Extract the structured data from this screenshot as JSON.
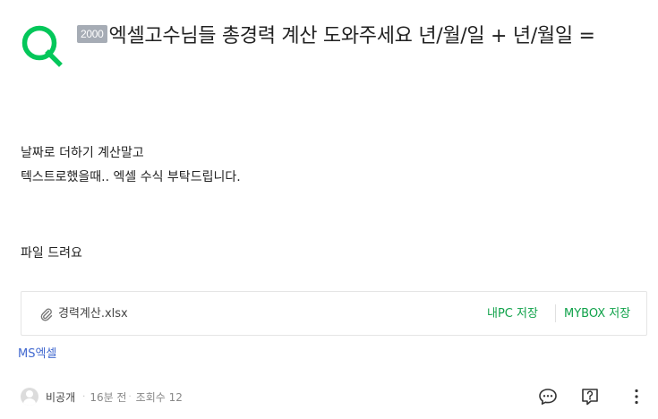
{
  "question": {
    "badge": "2000",
    "title": "엑셀고수님들 총경력 계산 도와주세요 년/월/일 + 년/월일 ="
  },
  "body": {
    "line1": "날짜로 더하기 계산말고",
    "line2": "텍스트로했을때.. 엑셀 수식 부탁드립니다.",
    "line3": "파일 드려요"
  },
  "attachment": {
    "file_name": "경력계산.xlsx",
    "save_pc_label": "내PC 저장",
    "save_mybox_label": "MYBOX 저장"
  },
  "tag": {
    "label": "MS엑셀"
  },
  "meta": {
    "author": "비공개",
    "time": "16분 전",
    "views": "조회수 12"
  },
  "colors": {
    "brand_green": "#03c75a",
    "save_green": "#10a24a",
    "tag_blue": "#4168cf",
    "badge_gray": "#a6acb5"
  },
  "icons": [
    "question-q-icon",
    "paperclip-icon",
    "comment-icon",
    "question-icon",
    "more-icon",
    "avatar-icon"
  ]
}
